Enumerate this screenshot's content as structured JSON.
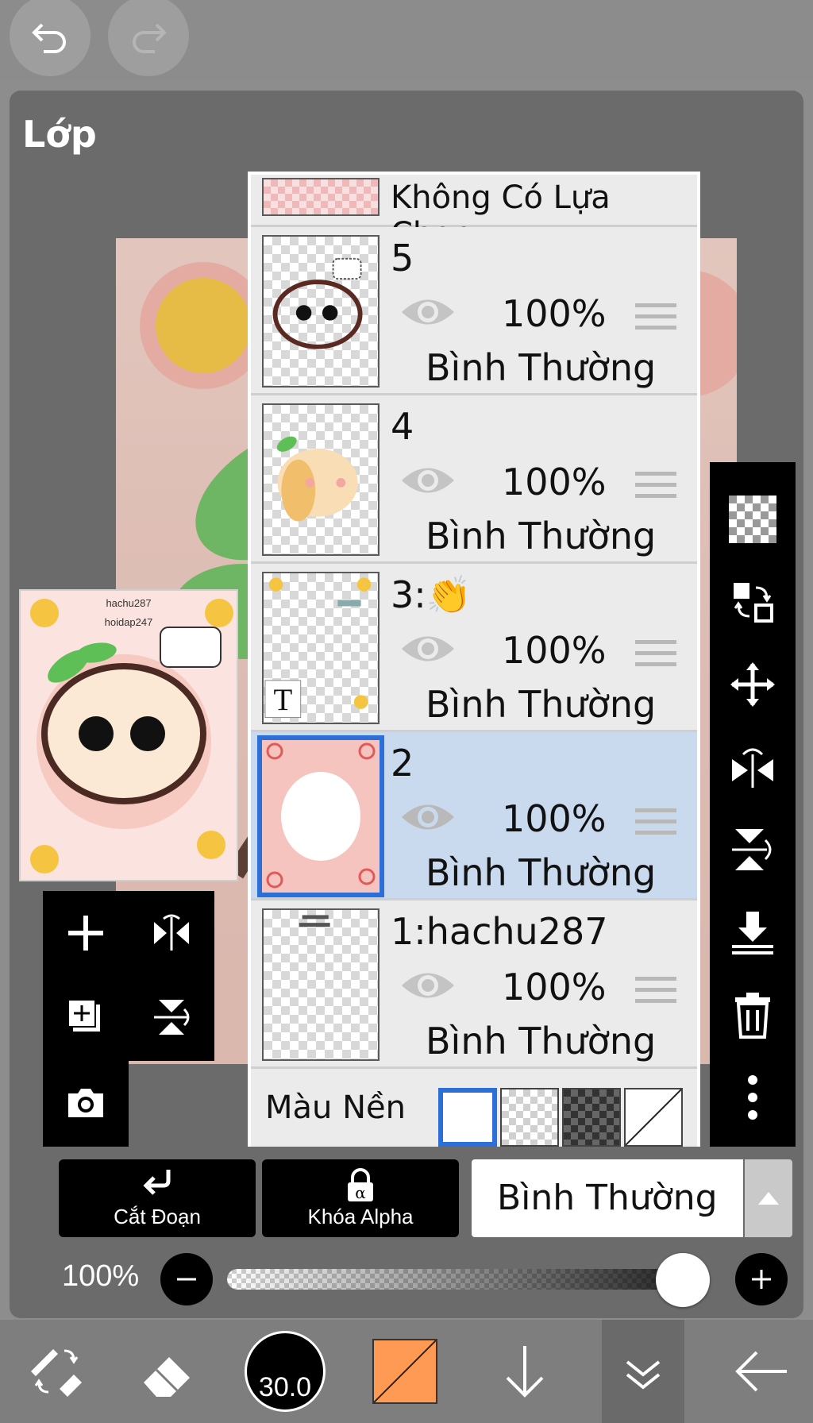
{
  "panel": {
    "title": "Lớp"
  },
  "thumbnail": {
    "text1": "hachu287",
    "text2": "hoidap247"
  },
  "selection_row": {
    "label": "Không Có Lựa Chọn"
  },
  "layers": [
    {
      "name": "5",
      "opacity": "100%",
      "mode": "Bình Thường",
      "selected": false
    },
    {
      "name": "4",
      "opacity": "100%",
      "mode": "Bình Thường",
      "selected": false
    },
    {
      "name": "3:👏",
      "opacity": "100%",
      "mode": "Bình Thường",
      "selected": false
    },
    {
      "name": "2",
      "opacity": "100%",
      "mode": "Bình Thường",
      "selected": true
    },
    {
      "name": "1:hachu287",
      "opacity": "100%",
      "mode": "Bình Thường",
      "selected": false
    }
  ],
  "background": {
    "label": "Màu Nền"
  },
  "actions": {
    "clipping": "Cắt Đoạn",
    "alpha_lock": "Khóa Alpha",
    "blend_mode": "Bình Thường"
  },
  "opacity": {
    "label": "100%",
    "value": 100
  },
  "toolbar": {
    "brush_size": "30.0",
    "color": "#ff9a55"
  },
  "colors": {
    "selected_row": "#c9d9ee",
    "selected_border": "#2c6fd6",
    "panel_bg": "#6b6b6b"
  }
}
